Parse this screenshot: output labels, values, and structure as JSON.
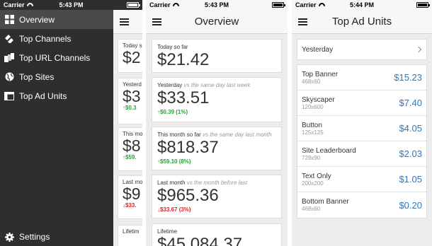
{
  "status": {
    "carrier": "Carrier",
    "time_1": "5:43 PM",
    "time_2": "5:43 PM",
    "time_3": "5:44 PM"
  },
  "menu": {
    "items": [
      {
        "label": "Overview",
        "icon": "grid-icon"
      },
      {
        "label": "Top Channels",
        "icon": "channels-icon"
      },
      {
        "label": "Top URL Channels",
        "icon": "url-channels-icon"
      },
      {
        "label": "Top Sites",
        "icon": "globe-icon"
      },
      {
        "label": "Top Ad Units",
        "icon": "ad-unit-icon"
      }
    ],
    "settings": "Settings"
  },
  "peek": {
    "cards": [
      {
        "label": "Today s",
        "value": "$2",
        "change": ""
      },
      {
        "label": "Yesterd",
        "value": "$3",
        "change": "↑$0.3"
      },
      {
        "label": "This mo",
        "value": "$8",
        "change": "↑$59."
      },
      {
        "label": "Last mo",
        "value": "$9",
        "change": "↓$33."
      },
      {
        "label": "Lifetim",
        "value": "",
        "change": ""
      }
    ]
  },
  "overview": {
    "title": "Overview",
    "cards": [
      {
        "label": "Today so far",
        "sub": "",
        "value": "$21.42",
        "change": ""
      },
      {
        "label": "Yesterday",
        "sub": "vs the same day last week",
        "value": "$33.51",
        "change": "↑$0.39 (1%)"
      },
      {
        "label": "This month so far",
        "sub": "vs the same day last month",
        "value": "$818.37",
        "change": "↑$59.10 (8%)"
      },
      {
        "label": "Last month",
        "sub": "vs the month before last",
        "value": "$965.36",
        "change": "↓$33.67 (3%)"
      },
      {
        "label": "Lifetime",
        "sub": "",
        "value": "$45,084.37",
        "change": ""
      }
    ]
  },
  "adunits": {
    "title": "Top Ad Units",
    "filter": "Yesterday",
    "rows": [
      {
        "name": "Top Banner",
        "size": "468x60",
        "value": "$15.23"
      },
      {
        "name": "Skyscaper",
        "size": "120x600",
        "value": "$7.40"
      },
      {
        "name": "Button",
        "size": "125x125",
        "value": "$4.05"
      },
      {
        "name": "Site Leaderboard",
        "size": "728x90",
        "value": "$2.03"
      },
      {
        "name": "Text Only",
        "size": "200x200",
        "value": "$1.05"
      },
      {
        "name": "Bottom Banner",
        "size": "468x60",
        "value": "$0.20"
      }
    ]
  },
  "colors": {
    "up": "#2aa13a",
    "down": "#d9262a",
    "link": "#2b78c5"
  }
}
